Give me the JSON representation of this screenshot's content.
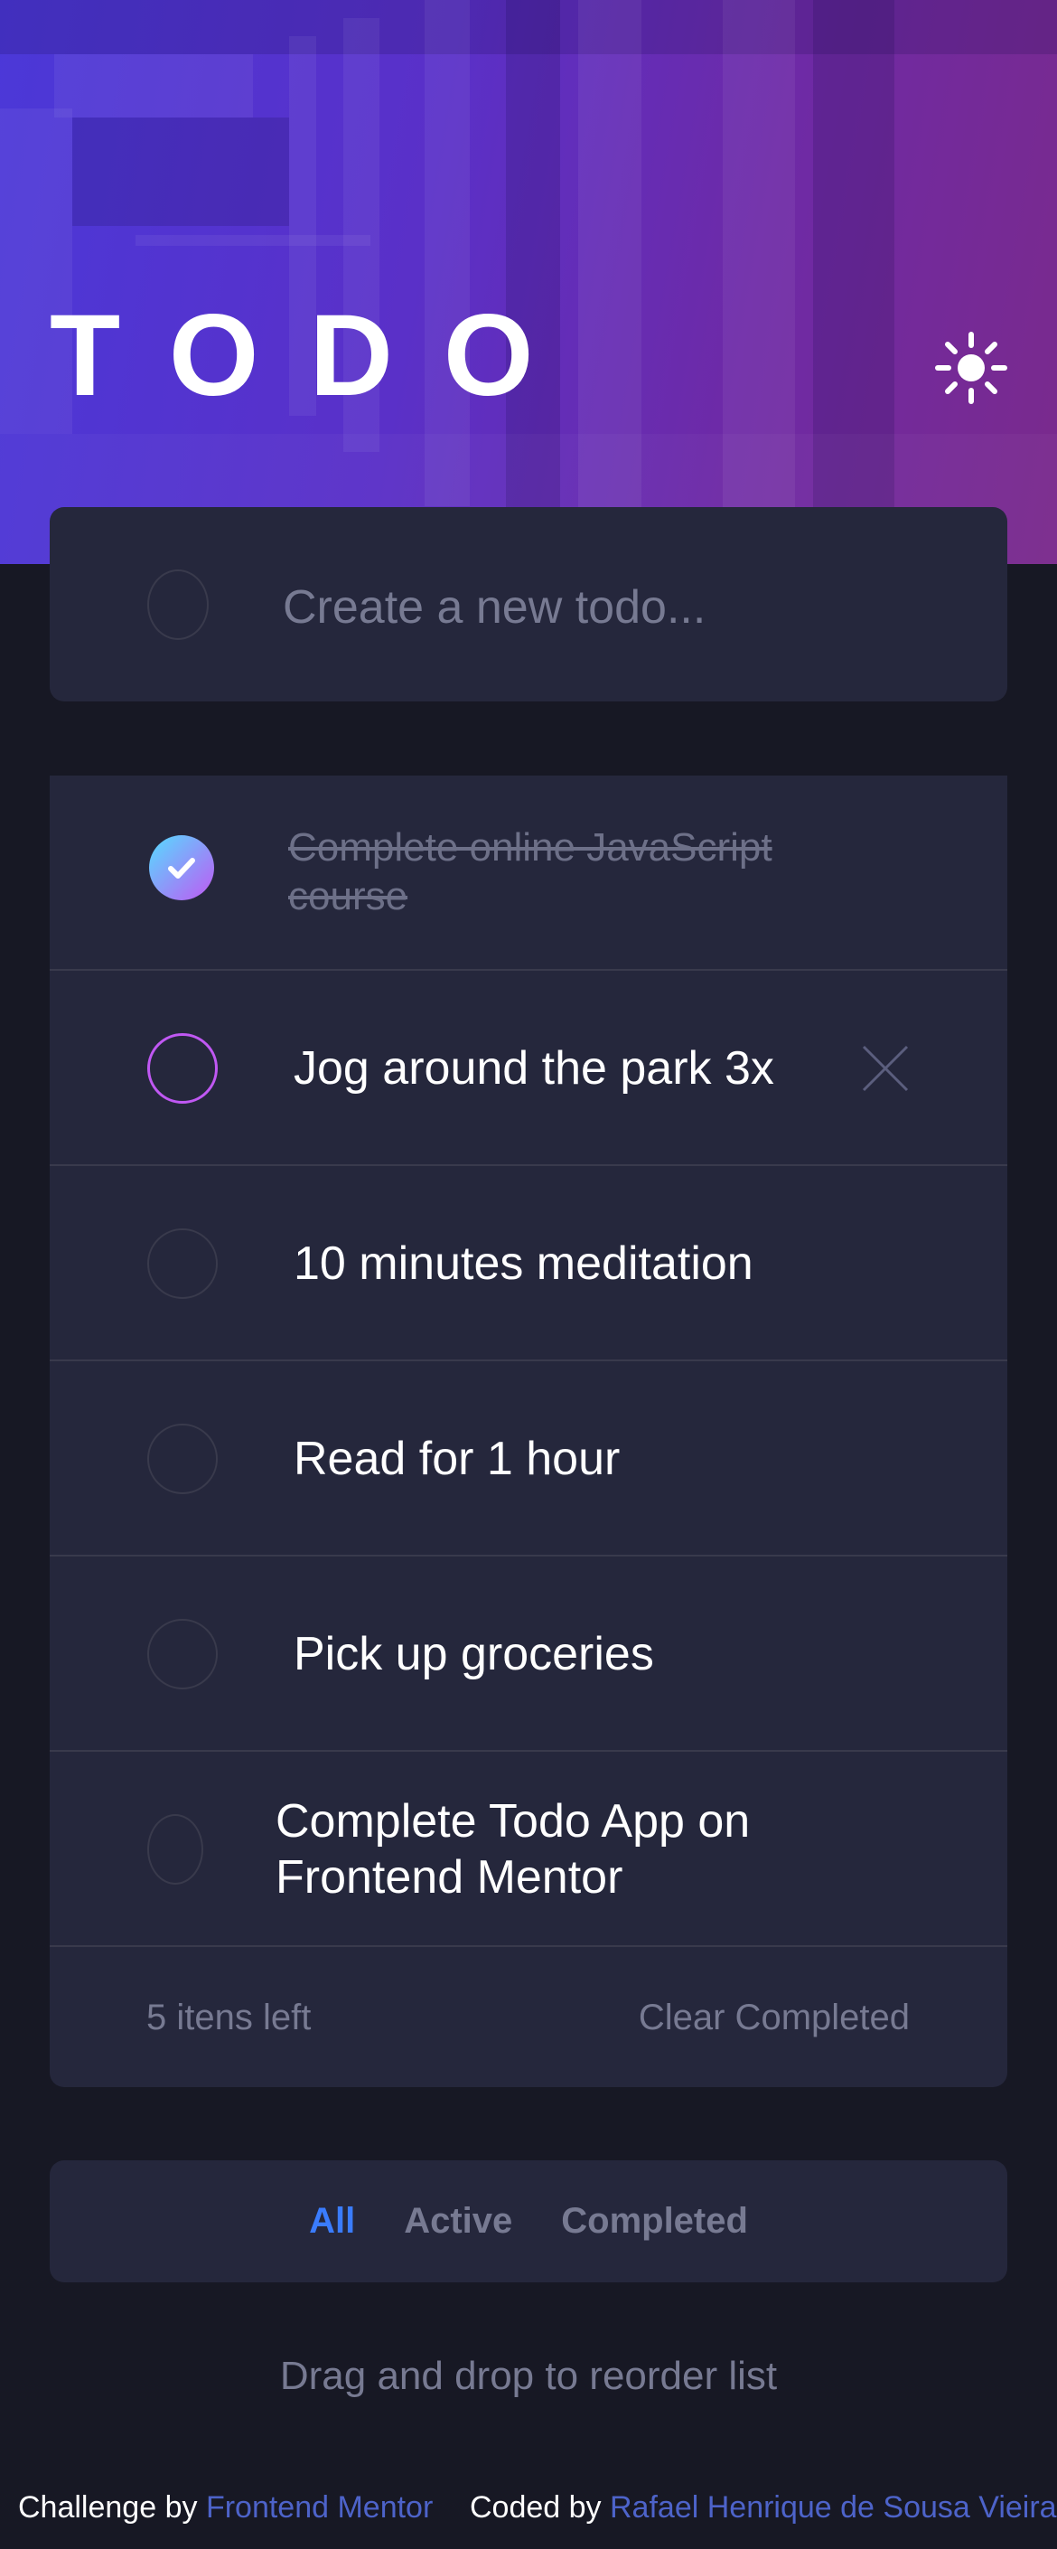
{
  "header": {
    "title": "TODO",
    "theme_icon": "sun-icon"
  },
  "new_todo": {
    "placeholder": "Create a new todo...",
    "value": ""
  },
  "todos": [
    {
      "label": "Complete online JavaScript course",
      "completed": true
    },
    {
      "label": "Jog around the park 3x",
      "completed": false,
      "hovered": true
    },
    {
      "label": "10 minutes meditation",
      "completed": false
    },
    {
      "label": "Read for 1 hour",
      "completed": false
    },
    {
      "label": "Pick up groceries",
      "completed": false
    },
    {
      "label": "Complete Todo App on Frontend Mentor",
      "completed": false
    }
  ],
  "list_footer": {
    "items_left": "5 itens left",
    "clear_label": "Clear Completed"
  },
  "filters": {
    "all": "All",
    "active": "Active",
    "completed": "Completed",
    "selected": "All"
  },
  "hint": "Drag and drop to reorder list",
  "attribution": {
    "challenge_prefix": "Challenge by",
    "challenge_link": "Frontend Mentor",
    "coded_prefix": "Coded by",
    "coded_link": "Rafael Henrique de Sousa Vieira"
  },
  "colors": {
    "background": "#171824",
    "card": "#25273c",
    "accent_blue": "#3a7cfd",
    "check_gradient_start": "#55ddff",
    "check_gradient_end": "#c058f3",
    "muted_text": "#777a92"
  }
}
